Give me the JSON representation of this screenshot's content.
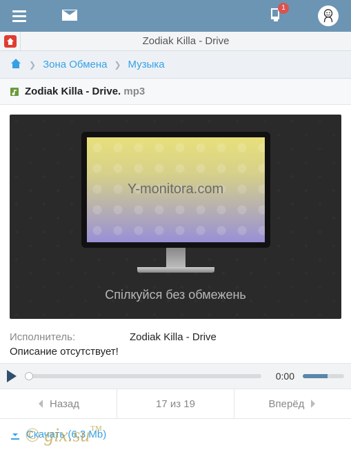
{
  "topbar": {
    "badge": "1"
  },
  "titlebar": {
    "title": "Zodiak Killa - Drive"
  },
  "breadcrumb": {
    "items": [
      {
        "label": "Зона Обмена"
      },
      {
        "label": "Музыка"
      }
    ]
  },
  "file": {
    "name": "Zodiak Killa - Drive. ",
    "ext": "mp3"
  },
  "ad": {
    "screen_text": "Y-monitora.com",
    "caption": "Спілкуйся без обмежень"
  },
  "info": {
    "artist_label": "Исполнитель:",
    "artist_value": "Zodiak Killa - Drive",
    "description": "Описание отсутствует!"
  },
  "player": {
    "time": "0:00"
  },
  "nav": {
    "prev": "Назад",
    "counter": "17 из 19",
    "next": "Вперёд"
  },
  "download": {
    "label": "Скачать (6.3 Mb)"
  },
  "watermark": {
    "text": "© gix.su",
    "tm": "™"
  }
}
